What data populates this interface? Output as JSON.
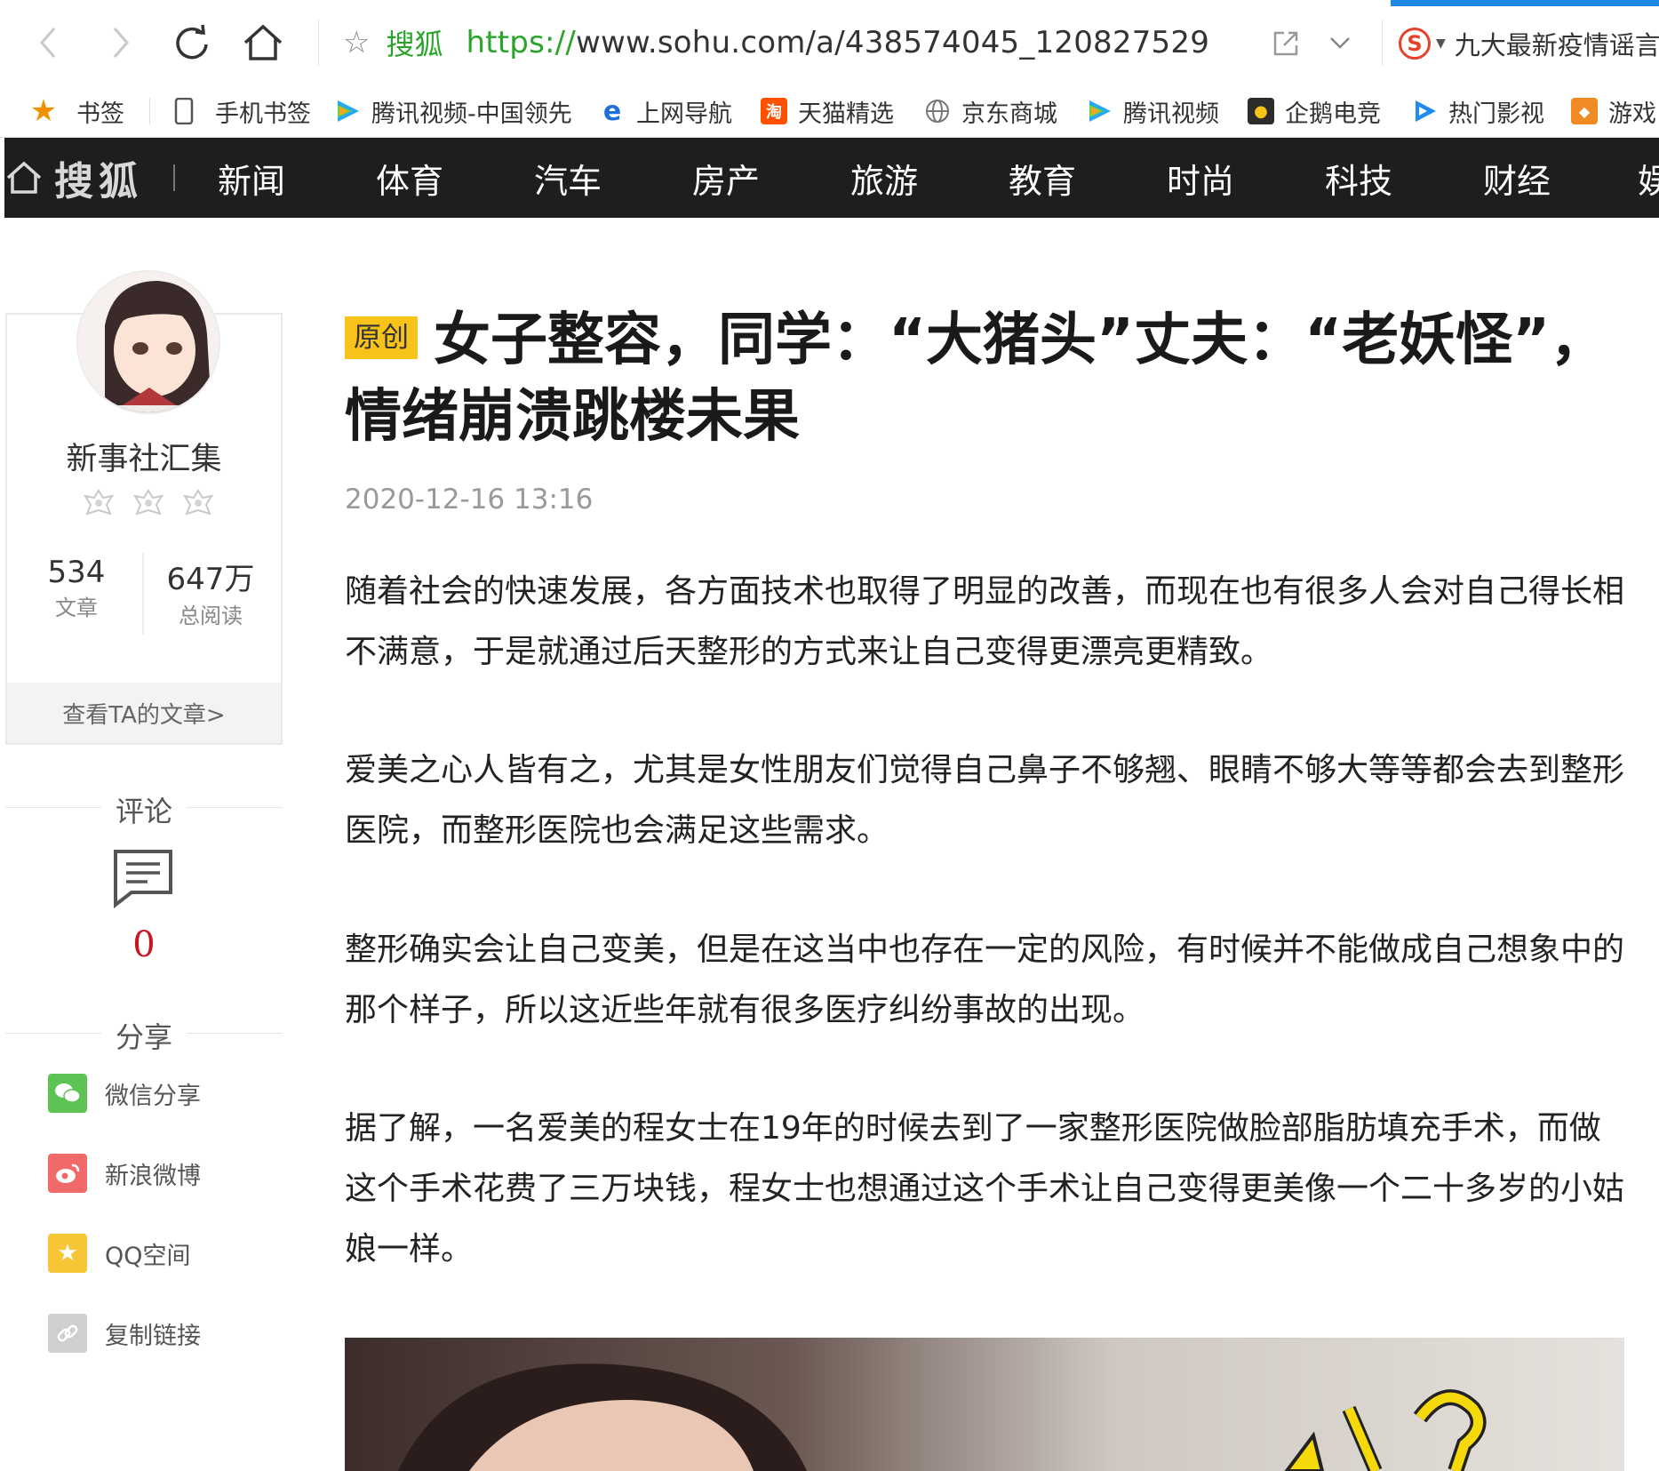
{
  "browser": {
    "back_label": "‹",
    "forward_label": "›",
    "site_name": "搜狐",
    "url_protocol": "https://",
    "url_rest": "www.sohu.com/a/438574045_120827529",
    "search_hint": "九大最新疫情谣言"
  },
  "bookmarks": [
    {
      "label": "书签",
      "icon": "star-icon"
    },
    {
      "label": "手机书签",
      "icon": "phone-icon"
    },
    {
      "label": "腾讯视频-中国领先",
      "icon": "tencent-video-icon"
    },
    {
      "label": "上网导航",
      "icon": "ie-icon"
    },
    {
      "label": "天猫精选",
      "icon": "tmall-icon"
    },
    {
      "label": "京东商城",
      "icon": "globe-icon"
    },
    {
      "label": "腾讯视频",
      "icon": "tencent-video-icon"
    },
    {
      "label": "企鹅电竞",
      "icon": "penguin-esports-icon"
    },
    {
      "label": "热门影视",
      "icon": "play-icon"
    },
    {
      "label": "游戏",
      "icon": "gamepad-icon"
    }
  ],
  "sohu_nav": {
    "logo": "搜狐",
    "items": [
      "新闻",
      "体育",
      "汽车",
      "房产",
      "旅游",
      "教育",
      "时尚",
      "科技",
      "财经",
      "娱"
    ]
  },
  "author": {
    "name": "新事社汇集",
    "articles_count": "534",
    "articles_label": "文章",
    "reads_count": "647万",
    "reads_label": "总阅读",
    "view_link": "查看TA的文章>"
  },
  "comments": {
    "label": "评论",
    "count": "0"
  },
  "share": {
    "label": "分享",
    "items": [
      {
        "label": "微信分享",
        "color": "#5dc453"
      },
      {
        "label": "新浪微博",
        "color": "#f06a6a"
      },
      {
        "label": "QQ空间",
        "color": "#f7c637"
      },
      {
        "label": "复制链接",
        "color": "#cfcfcf"
      }
    ]
  },
  "article": {
    "tag": "原创",
    "title": "女子整容，同学：“大猪头”丈夫：“老妖怪”，情绪崩溃跳楼未果",
    "date": "2020-12-16 13:16",
    "paragraphs": [
      "随着社会的快速发展，各方面技术也取得了明显的改善，而现在也有很多人会对自己得长相不满意，于是就通过后天整形的方式来让自己变得更漂亮更精致。",
      "爱美之心人皆有之，尤其是女性朋友们觉得自己鼻子不够翘、眼睛不够大等等都会去到整形医院，而整形医院也会满足这些需求。",
      "整形确实会让自己变美，但是在这当中也存在一定的风险，有时候并不能做成自己想象中的那个样子，所以这近些年就有很多医疗纠纷事故的出现。",
      "据了解，一名爱美的程女士在19年的时候去到了一家整形医院做脸部脂肪填充手术，而做这个手术花费了三万块钱，程女士也想通过这个手术让自己变得更美像一个二十多岁的小姑娘一样。"
    ]
  }
}
